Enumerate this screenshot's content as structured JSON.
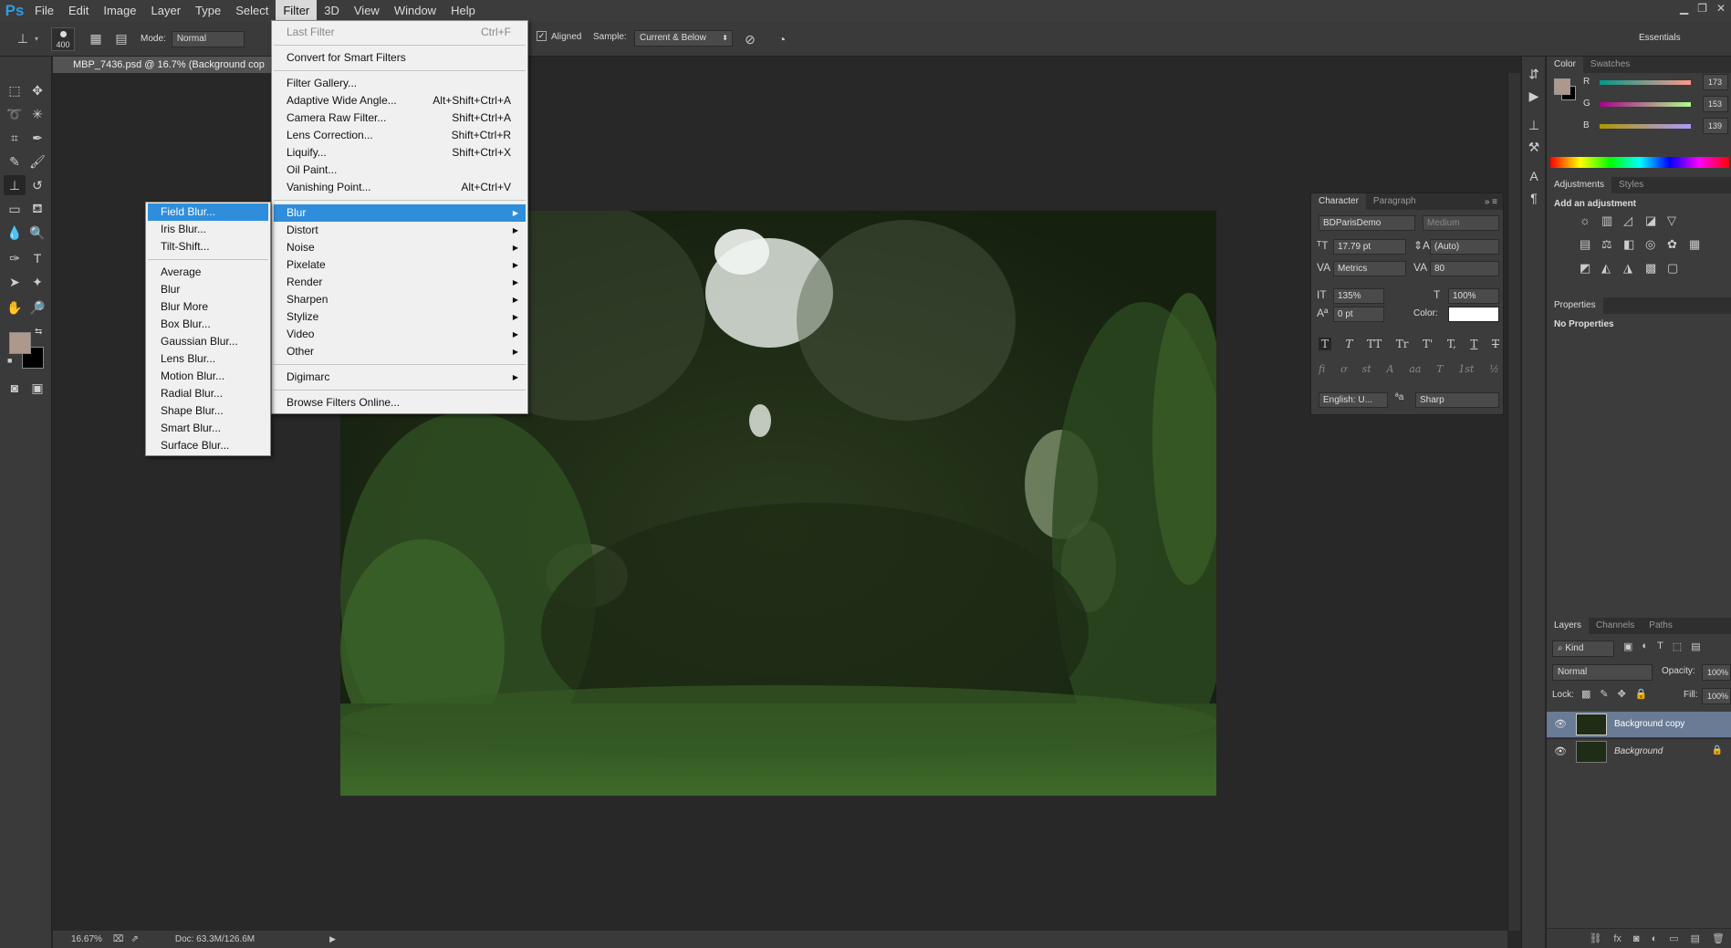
{
  "menubar": {
    "logo": "Ps",
    "items": [
      "File",
      "Edit",
      "Image",
      "Layer",
      "Type",
      "Select",
      "Filter",
      "3D",
      "View",
      "Window",
      "Help"
    ],
    "active_index": 6
  },
  "options_bar": {
    "brush_size": "400",
    "mode_label": "Mode:",
    "mode_value": "Normal",
    "aligned_label": "Aligned",
    "sample_label": "Sample:",
    "sample_value": "Current & Below",
    "workspace": "Essentials"
  },
  "document": {
    "tab_title": "MBP_7436.psd @ 16.7% (Background cop",
    "zoom": "16.67%",
    "doc_size": "Doc: 63.3M/126.6M"
  },
  "filter_menu": {
    "items": [
      {
        "label": "Last Filter",
        "shortcut": "Ctrl+F",
        "disabled": true
      },
      {
        "sep": true
      },
      {
        "label": "Convert for Smart Filters"
      },
      {
        "sep": true
      },
      {
        "label": "Filter Gallery..."
      },
      {
        "label": "Adaptive Wide Angle...",
        "shortcut": "Alt+Shift+Ctrl+A"
      },
      {
        "label": "Camera Raw Filter...",
        "shortcut": "Shift+Ctrl+A"
      },
      {
        "label": "Lens Correction...",
        "shortcut": "Shift+Ctrl+R"
      },
      {
        "label": "Liquify...",
        "shortcut": "Shift+Ctrl+X"
      },
      {
        "label": "Oil Paint..."
      },
      {
        "label": "Vanishing Point...",
        "shortcut": "Alt+Ctrl+V"
      },
      {
        "sep": true
      },
      {
        "label": "Blur",
        "submenu": true,
        "highlighted": true
      },
      {
        "label": "Distort",
        "submenu": true
      },
      {
        "label": "Noise",
        "submenu": true
      },
      {
        "label": "Pixelate",
        "submenu": true
      },
      {
        "label": "Render",
        "submenu": true
      },
      {
        "label": "Sharpen",
        "submenu": true
      },
      {
        "label": "Stylize",
        "submenu": true
      },
      {
        "label": "Video",
        "submenu": true
      },
      {
        "label": "Other",
        "submenu": true
      },
      {
        "sep": true
      },
      {
        "label": "Digimarc",
        "submenu": true
      },
      {
        "sep": true
      },
      {
        "label": "Browse Filters Online..."
      }
    ]
  },
  "blur_submenu": {
    "items": [
      {
        "label": "Field Blur...",
        "highlighted": true
      },
      {
        "label": "Iris Blur..."
      },
      {
        "label": "Tilt-Shift..."
      },
      {
        "sep": true
      },
      {
        "label": "Average"
      },
      {
        "label": "Blur"
      },
      {
        "label": "Blur More"
      },
      {
        "label": "Box Blur..."
      },
      {
        "label": "Gaussian Blur..."
      },
      {
        "label": "Lens Blur..."
      },
      {
        "label": "Motion Blur..."
      },
      {
        "label": "Radial Blur..."
      },
      {
        "label": "Shape Blur..."
      },
      {
        "label": "Smart Blur..."
      },
      {
        "label": "Surface Blur..."
      }
    ]
  },
  "color_panel": {
    "tabs": [
      "Color",
      "Swatches"
    ],
    "r_label": "R",
    "r_value": "173",
    "g_label": "G",
    "g_value": "153",
    "b_label": "B",
    "b_value": "139",
    "foreground": "#ad998b",
    "background": "#000000"
  },
  "adjustments_panel": {
    "tabs": [
      "Adjustments",
      "Styles"
    ],
    "heading": "Add an adjustment"
  },
  "properties_panel": {
    "tab": "Properties",
    "text": "No Properties"
  },
  "character_panel": {
    "tabs": [
      "Character",
      "Paragraph"
    ],
    "font_family": "BDParisDemo",
    "font_style": "Medium",
    "font_size": "17.79 pt",
    "leading": "(Auto)",
    "kerning": "Metrics",
    "tracking": "80",
    "vertical_scale": "135%",
    "horizontal_scale": "100%",
    "baseline_shift": "0 pt",
    "color_label": "Color:",
    "language": "English: U...",
    "antialias": "Sharp",
    "style_glyphs": [
      "T",
      "T",
      "TT",
      "Tr",
      "T'",
      "T,",
      "T",
      "T"
    ],
    "ot_glyphs": [
      "fi",
      "ơ",
      "st",
      "A",
      "aa",
      "T",
      "1st",
      "½"
    ]
  },
  "layers_panel": {
    "tabs": [
      "Layers",
      "Channels",
      "Paths"
    ],
    "kind_label": "Kind",
    "blend_mode": "Normal",
    "opacity_label": "Opacity:",
    "opacity_value": "100%",
    "lock_label": "Lock:",
    "fill_label": "Fill:",
    "fill_value": "100%",
    "layers": [
      {
        "name": "Background copy",
        "selected": true
      },
      {
        "name": "Background",
        "locked": true
      }
    ]
  }
}
